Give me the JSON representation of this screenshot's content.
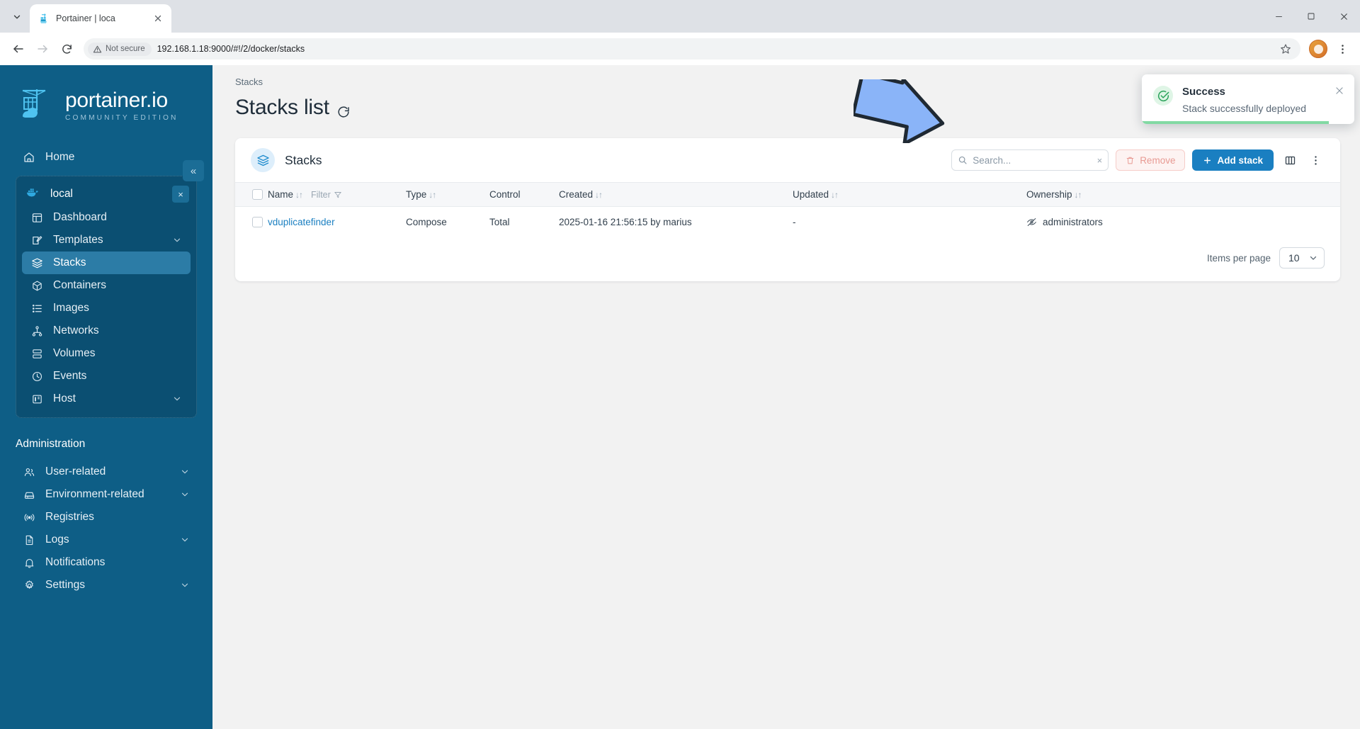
{
  "browser": {
    "tab": {
      "title": "Portainer | loca",
      "favicon": "portainer-favicon"
    },
    "tab_list_icon": "chevron-down-icon",
    "close_tab_icon": "close-icon",
    "back_icon": "back-arrow-icon",
    "forward_icon": "forward-arrow-icon",
    "reload_icon": "reload-icon",
    "security_label": "Not secure",
    "security_icon": "warning-triangle-icon",
    "url": "192.168.1.18:9000/#!/2/docker/stacks",
    "bookmark_icon": "star-icon",
    "profile_icon": "profile-avatar",
    "menu_icon": "kebab-menu-icon",
    "minimize_icon": "minimize-icon",
    "maximize_icon": "maximize-icon",
    "window_close_icon": "close-icon"
  },
  "sidebar": {
    "logo_name": "portainer.io",
    "logo_sub": "COMMUNITY EDITION",
    "collapse_icon": "«",
    "home": {
      "label": "Home",
      "icon": "home-icon"
    },
    "environment": {
      "label": "local",
      "icon": "docker-whale-icon",
      "close_icon": "×"
    },
    "env_items": [
      {
        "label": "Dashboard",
        "icon": "dashboard-icon",
        "chevron": false
      },
      {
        "label": "Templates",
        "icon": "templates-icon",
        "chevron": true
      },
      {
        "label": "Stacks",
        "icon": "stacks-icon",
        "chevron": false,
        "active": true
      },
      {
        "label": "Containers",
        "icon": "containers-icon",
        "chevron": false
      },
      {
        "label": "Images",
        "icon": "images-icon",
        "chevron": false
      },
      {
        "label": "Networks",
        "icon": "networks-icon",
        "chevron": false
      },
      {
        "label": "Volumes",
        "icon": "volumes-icon",
        "chevron": false
      },
      {
        "label": "Events",
        "icon": "events-clock-icon",
        "chevron": false
      },
      {
        "label": "Host",
        "icon": "host-icon",
        "chevron": true
      }
    ],
    "admin_title": "Administration",
    "admin_items": [
      {
        "label": "User-related",
        "icon": "users-icon",
        "chevron": true
      },
      {
        "label": "Environment-related",
        "icon": "environment-icon",
        "chevron": true
      },
      {
        "label": "Registries",
        "icon": "registries-icon",
        "chevron": false
      },
      {
        "label": "Logs",
        "icon": "logs-icon",
        "chevron": true
      },
      {
        "label": "Notifications",
        "icon": "bell-icon",
        "chevron": false
      },
      {
        "label": "Settings",
        "icon": "gear-icon",
        "chevron": true
      }
    ]
  },
  "page": {
    "breadcrumb": "Stacks",
    "title": "Stacks list",
    "refresh_icon": "refresh-icon"
  },
  "card": {
    "icon": "stacks-icon",
    "title": "Stacks",
    "search": {
      "placeholder": "Search...",
      "value": "",
      "icon": "search-icon",
      "clear_icon": "×"
    },
    "remove_button": {
      "label": "Remove",
      "icon": "trash-icon",
      "disabled": true
    },
    "add_button": {
      "label": "Add stack",
      "icon": "plus-icon"
    },
    "columns_icon": "columns-layout-icon",
    "menu_icon": "kebab-menu-icon"
  },
  "table": {
    "sort_icon": "↓↑",
    "filter_label": "Filter",
    "filter_icon": "funnel-icon",
    "columns": [
      {
        "label": "Name",
        "sortable": true,
        "filter": true
      },
      {
        "label": "Type",
        "sortable": true,
        "filter": false
      },
      {
        "label": "Control",
        "sortable": false,
        "filter": false
      },
      {
        "label": "Created",
        "sortable": true,
        "filter": false
      },
      {
        "label": "Updated",
        "sortable": true,
        "filter": false
      },
      {
        "label": "Ownership",
        "sortable": true,
        "filter": false
      }
    ],
    "rows": [
      {
        "name": "vduplicatefinder",
        "type": "Compose",
        "control": "Total",
        "created": "2025-01-16 21:56:15 by marius",
        "updated": "-",
        "ownership": "administrators",
        "ownership_icon": "eye-slash-icon"
      }
    ]
  },
  "footer": {
    "items_per_page_label": "Items per page",
    "items_per_page_value": "10",
    "chevron_icon": "chevron-down-icon"
  },
  "toast": {
    "title": "Success",
    "message": "Stack successfully deployed",
    "icon": "check-circle-icon",
    "close_icon": "×"
  },
  "annotation": {
    "shape": "arrow-pointing-down-right",
    "color": "#8ab4f8"
  },
  "colors": {
    "sidebar_bg": "#0e5e86",
    "sidebar_group_bg": "#0b4f72",
    "active_item": "#2c7ca6",
    "accent_blue": "#1a7fc1",
    "success_green": "#2ba35b",
    "danger_red": "#e89a93"
  }
}
